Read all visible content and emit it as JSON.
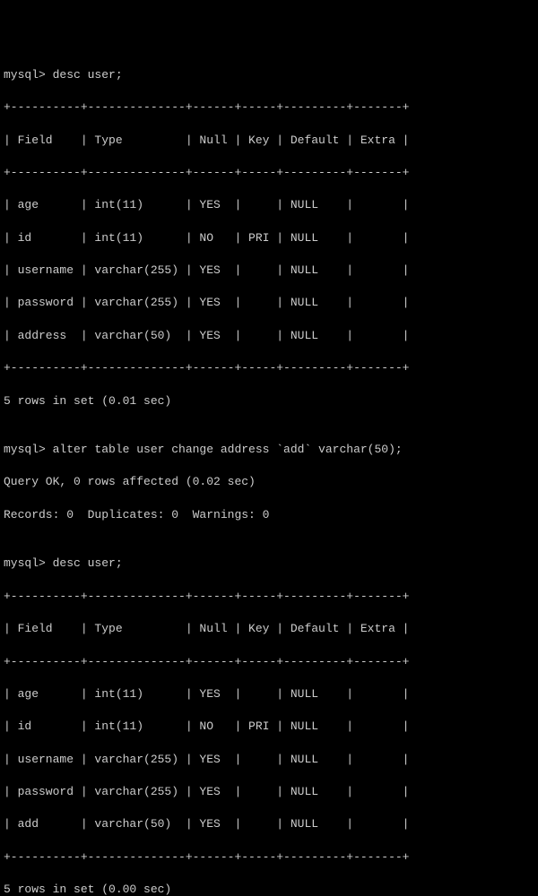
{
  "session": {
    "prompt1": "mysql> desc user;",
    "table1": {
      "border_top": "+----------+--------------+------+-----+---------+-------+",
      "header": "| Field    | Type         | Null | Key | Default | Extra |",
      "border_mid": "+----------+--------------+------+-----+---------+-------+",
      "rows": [
        "| age      | int(11)      | YES  |     | NULL    |       |",
        "| id       | int(11)      | NO   | PRI | NULL    |       |",
        "| username | varchar(255) | YES  |     | NULL    |       |",
        "| password | varchar(255) | YES  |     | NULL    |       |",
        "| address  | varchar(50)  | YES  |     | NULL    |       |"
      ],
      "border_bot": "+----------+--------------+------+-----+---------+-------+"
    },
    "result1": "5 rows in set (0.01 sec)",
    "blank1": "",
    "prompt2": "mysql> alter table user change address `add` varchar(50);",
    "result2a": "Query OK, 0 rows affected (0.02 sec)",
    "result2b": "Records: 0  Duplicates: 0  Warnings: 0",
    "blank2": "",
    "prompt3": "mysql> desc user;",
    "table2": {
      "border_top": "+----------+--------------+------+-----+---------+-------+",
      "header": "| Field    | Type         | Null | Key | Default | Extra |",
      "border_mid": "+----------+--------------+------+-----+---------+-------+",
      "rows": [
        "| age      | int(11)      | YES  |     | NULL    |       |",
        "| id       | int(11)      | NO   | PRI | NULL    |       |",
        "| username | varchar(255) | YES  |     | NULL    |       |",
        "| password | varchar(255) | YES  |     | NULL    |       |",
        "| add      | varchar(50)  | YES  |     | NULL    |       |"
      ],
      "border_bot": "+----------+--------------+------+-----+---------+-------+"
    },
    "result3": "5 rows in set (0.00 sec)"
  }
}
